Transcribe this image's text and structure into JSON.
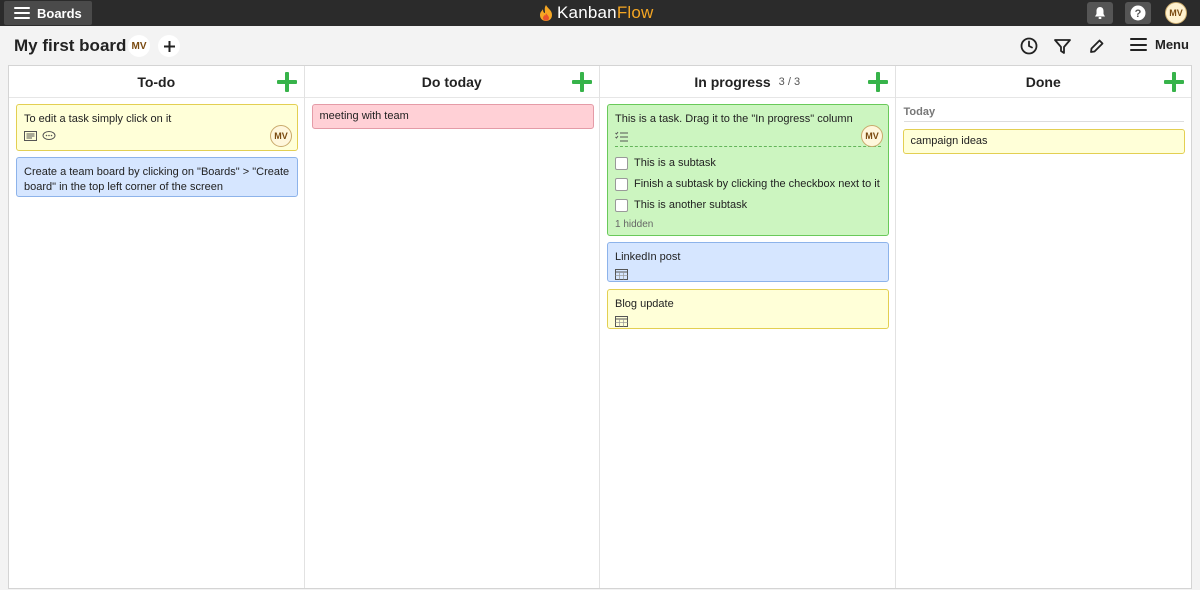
{
  "topbar": {
    "boards_label": "Boards",
    "logo_part1": "Kanban",
    "logo_part2": "Flow",
    "user_initials": "MV"
  },
  "header": {
    "board_title": "My first board",
    "member_initials": "MV",
    "menu_label": "Menu"
  },
  "columns": [
    {
      "name": "To-do",
      "count": ""
    },
    {
      "name": "Do today",
      "count": ""
    },
    {
      "name": "In progress",
      "count": "3 / 3"
    },
    {
      "name": "Done",
      "count": ""
    }
  ],
  "tasks": {
    "todo": [
      {
        "text": "To edit a task simply click on it",
        "color": "yellow",
        "assignee": "MV"
      },
      {
        "text": "Create a team board by clicking on \"Boards\" > \"Create board\" in the top left corner of the screen",
        "color": "blue"
      }
    ],
    "today": [
      {
        "text": "meeting with team",
        "color": "pink"
      }
    ],
    "progress": [
      {
        "text": "This is a task. Drag it to the \"In progress\" column",
        "color": "green",
        "assignee": "MV",
        "subtasks": [
          "This is a subtask",
          "Finish a subtask by clicking the checkbox next to it",
          "This is another subtask"
        ],
        "hidden_note": "1 hidden"
      },
      {
        "text": "LinkedIn post",
        "color": "blue"
      },
      {
        "text": "Blog update",
        "color": "yellow"
      }
    ],
    "done": [
      {
        "text": "campaign ideas",
        "color": "yellow"
      }
    ]
  },
  "done_group_label": "Today",
  "colors": {
    "topbar_bg": "#2b2b2b",
    "add_green": "#37b34a",
    "logo_orange": "#f5a623",
    "card_yellow": "#ffffd8",
    "card_blue": "#d6e6ff",
    "card_pink": "#ffd0d6",
    "card_green": "#ccf5c0"
  },
  "icons": [
    "hamburger-icon",
    "logo-flame-icon",
    "bell-icon",
    "help-icon",
    "plus-icon",
    "clock-icon",
    "filter-icon",
    "pencil-icon",
    "description-icon",
    "comment-icon",
    "subtask-list-icon",
    "calendar-icon"
  ]
}
